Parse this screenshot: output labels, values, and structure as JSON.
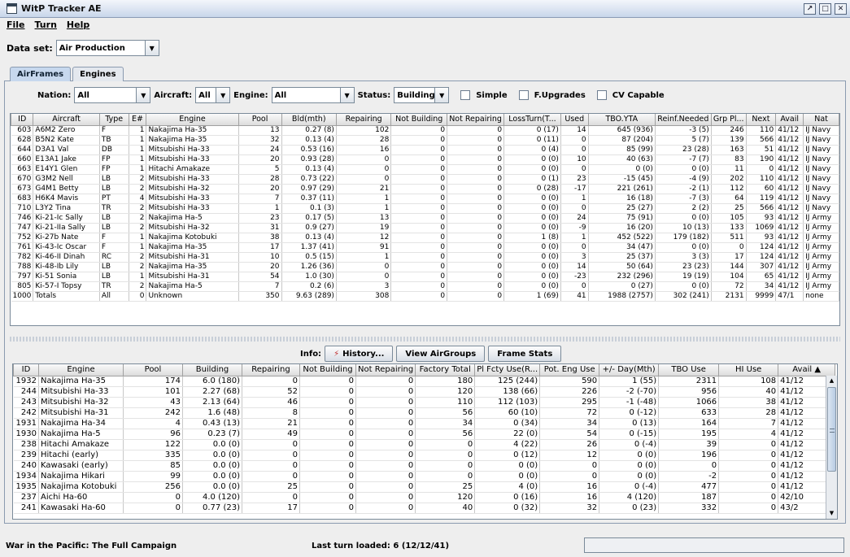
{
  "window": {
    "title": "WitP Tracker AE",
    "buttons": [
      "↗",
      "□",
      "✕"
    ]
  },
  "menu": [
    "File",
    "Turn",
    "Help"
  ],
  "dataset": {
    "label": "Data set:",
    "value": "Air Production"
  },
  "tabs": [
    "AirFrames",
    "Engines"
  ],
  "filters": {
    "nation_label": "Nation:",
    "nation": "All",
    "aircraft_label": "Aircraft:",
    "aircraft": "All",
    "engine_label": "Engine:",
    "engine": "All",
    "status_label": "Status:",
    "status": "Building",
    "simple": "Simple",
    "fupgrades": "F.Upgrades",
    "cvcapable": "CV Capable"
  },
  "airframes": {
    "columns": [
      "ID",
      "Aircraft",
      "Type",
      "E#",
      "Engine",
      "Pool",
      "Bld(mth)",
      "Repairing",
      "Not Building",
      "Not Repairing",
      "LossTurn(T...",
      "Used",
      "TBO.YTA",
      "Reinf.Needed",
      "Grp Pl...",
      "Next",
      "Avail",
      "Nat"
    ],
    "rows": [
      [
        "603",
        "A6M2 Zero",
        "F",
        "1",
        "Nakajima Ha-35",
        "13",
        "0.27 (8)",
        "102",
        "0",
        "0",
        "0 (17)",
        "14",
        "645 (936)",
        "-3 (5)",
        "246",
        "110",
        "41/12",
        "IJ Navy"
      ],
      [
        "628",
        "B5N2 Kate",
        "TB",
        "1",
        "Nakajima Ha-35",
        "32",
        "0.13 (4)",
        "28",
        "0",
        "0",
        "0 (11)",
        "0",
        "87 (204)",
        "5 (7)",
        "139",
        "566",
        "41/12",
        "IJ Navy"
      ],
      [
        "644",
        "D3A1 Val",
        "DB",
        "1",
        "Mitsubishi Ha-33",
        "24",
        "0.53 (16)",
        "16",
        "0",
        "0",
        "0 (4)",
        "0",
        "85 (99)",
        "23 (28)",
        "163",
        "51",
        "41/12",
        "IJ Navy"
      ],
      [
        "660",
        "E13A1 Jake",
        "FP",
        "1",
        "Mitsubishi Ha-33",
        "20",
        "0.93 (28)",
        "0",
        "0",
        "0",
        "0 (0)",
        "10",
        "40 (63)",
        "-7 (7)",
        "83",
        "190",
        "41/12",
        "IJ Navy"
      ],
      [
        "663",
        "E14Y1 Glen",
        "FP",
        "1",
        "Hitachi Amakaze",
        "5",
        "0.13 (4)",
        "0",
        "0",
        "0",
        "0 (0)",
        "0",
        "0 (0)",
        "0 (0)",
        "11",
        "0",
        "41/12",
        "IJ Navy"
      ],
      [
        "670",
        "G3M2 Nell",
        "LB",
        "2",
        "Mitsubishi Ha-33",
        "28",
        "0.73 (22)",
        "0",
        "0",
        "0",
        "0 (1)",
        "23",
        "-15 (45)",
        "-4 (9)",
        "202",
        "110",
        "41/12",
        "IJ Navy"
      ],
      [
        "673",
        "G4M1 Betty",
        "LB",
        "2",
        "Mitsubishi Ha-32",
        "20",
        "0.97 (29)",
        "21",
        "0",
        "0",
        "0 (28)",
        "-17",
        "221 (261)",
        "-2 (1)",
        "112",
        "60",
        "41/12",
        "IJ Navy"
      ],
      [
        "683",
        "H6K4 Mavis",
        "PT",
        "4",
        "Mitsubishi Ha-33",
        "7",
        "0.37 (11)",
        "1",
        "0",
        "0",
        "0 (0)",
        "1",
        "16 (18)",
        "-7 (3)",
        "64",
        "119",
        "41/12",
        "IJ Navy"
      ],
      [
        "710",
        "L3Y2 Tina",
        "TR",
        "2",
        "Mitsubishi Ha-33",
        "1",
        "0.1 (3)",
        "1",
        "0",
        "0",
        "0 (0)",
        "0",
        "25 (27)",
        "2 (2)",
        "25",
        "566",
        "41/12",
        "IJ Navy"
      ],
      [
        "746",
        "Ki-21-Ic Sally",
        "LB",
        "2",
        "Nakajima Ha-5",
        "23",
        "0.17 (5)",
        "13",
        "0",
        "0",
        "0 (0)",
        "24",
        "75 (91)",
        "0 (0)",
        "105",
        "93",
        "41/12",
        "IJ Army"
      ],
      [
        "747",
        "Ki-21-IIa Sally",
        "LB",
        "2",
        "Mitsubishi Ha-32",
        "31",
        "0.9 (27)",
        "19",
        "0",
        "0",
        "0 (0)",
        "-9",
        "16 (20)",
        "10 (13)",
        "133",
        "1069",
        "41/12",
        "IJ Army"
      ],
      [
        "752",
        "Ki-27b Nate",
        "F",
        "1",
        "Nakajima Kotobuki",
        "38",
        "0.13 (4)",
        "12",
        "0",
        "0",
        "1 (8)",
        "1",
        "452 (522)",
        "179 (182)",
        "511",
        "93",
        "41/12",
        "IJ Army"
      ],
      [
        "761",
        "Ki-43-Ic Oscar",
        "F",
        "1",
        "Nakajima Ha-35",
        "17",
        "1.37 (41)",
        "91",
        "0",
        "0",
        "0 (0)",
        "0",
        "34 (47)",
        "0 (0)",
        "0",
        "124",
        "41/12",
        "IJ Army"
      ],
      [
        "782",
        "Ki-46-II Dinah",
        "RC",
        "2",
        "Mitsubishi Ha-31",
        "10",
        "0.5 (15)",
        "1",
        "0",
        "0",
        "0 (0)",
        "3",
        "25 (37)",
        "3 (3)",
        "17",
        "124",
        "41/12",
        "IJ Army"
      ],
      [
        "788",
        "Ki-48-Ib Lily",
        "LB",
        "2",
        "Nakajima Ha-35",
        "20",
        "1.26 (36)",
        "0",
        "0",
        "0",
        "0 (0)",
        "14",
        "50 (64)",
        "23 (23)",
        "144",
        "307",
        "41/12",
        "IJ Army"
      ],
      [
        "797",
        "Ki-51 Sonia",
        "LB",
        "1",
        "Mitsubishi Ha-31",
        "54",
        "1.0 (30)",
        "0",
        "0",
        "0",
        "0 (0)",
        "-23",
        "232 (296)",
        "19 (19)",
        "104",
        "65",
        "41/12",
        "IJ Army"
      ],
      [
        "805",
        "Ki-57-I Topsy",
        "TR",
        "2",
        "Nakajima Ha-5",
        "7",
        "0.2 (6)",
        "3",
        "0",
        "0",
        "0 (0)",
        "0",
        "0 (27)",
        "0 (0)",
        "72",
        "34",
        "41/12",
        "IJ Army"
      ],
      [
        "1000",
        "Totals",
        "All",
        "0",
        "Unknown",
        "350",
        "9.63 (289)",
        "308",
        "0",
        "0",
        "1 (69)",
        "41",
        "1988 (2757)",
        "302 (241)",
        "2131",
        "9999",
        "47/1",
        "none"
      ]
    ]
  },
  "info": {
    "label": "Info:",
    "history": "History...",
    "view_airgroups": "View AirGroups",
    "frame_stats": "Frame Stats"
  },
  "engines": {
    "columns": [
      "ID",
      "Engine",
      "Pool",
      "Building",
      "Repairing",
      "Not Building",
      "Not Repairing",
      "Factory Total",
      "Pl Fcty Use(R...",
      "Pot. Eng Use",
      "+/- Day(Mth)",
      "TBO Use",
      "HI Use",
      "Avail ▲"
    ],
    "rows": [
      [
        "1932",
        "Nakajima Ha-35",
        "174",
        "6.0 (180)",
        "0",
        "0",
        "0",
        "180",
        "125 (244)",
        "590",
        "1 (55)",
        "2311",
        "108",
        "41/12"
      ],
      [
        "244",
        "Mitsubishi Ha-33",
        "101",
        "2.27 (68)",
        "52",
        "0",
        "0",
        "120",
        "138 (66)",
        "226",
        "-2 (-70)",
        "956",
        "40",
        "41/12"
      ],
      [
        "243",
        "Mitsubishi Ha-32",
        "43",
        "2.13 (64)",
        "46",
        "0",
        "0",
        "110",
        "112 (103)",
        "295",
        "-1 (-48)",
        "1066",
        "38",
        "41/12"
      ],
      [
        "242",
        "Mitsubishi Ha-31",
        "242",
        "1.6 (48)",
        "8",
        "0",
        "0",
        "56",
        "60 (10)",
        "72",
        "0 (-12)",
        "633",
        "28",
        "41/12"
      ],
      [
        "1931",
        "Nakajima Ha-34",
        "4",
        "0.43 (13)",
        "21",
        "0",
        "0",
        "34",
        "0 (34)",
        "34",
        "0 (13)",
        "164",
        "7",
        "41/12"
      ],
      [
        "1930",
        "Nakajima Ha-5",
        "96",
        "0.23 (7)",
        "49",
        "0",
        "0",
        "56",
        "22 (0)",
        "54",
        "0 (-15)",
        "195",
        "4",
        "41/12"
      ],
      [
        "238",
        "Hitachi Amakaze",
        "122",
        "0.0 (0)",
        "0",
        "0",
        "0",
        "0",
        "4 (22)",
        "26",
        "0 (-4)",
        "39",
        "0",
        "41/12"
      ],
      [
        "239",
        "Hitachi (early)",
        "335",
        "0.0 (0)",
        "0",
        "0",
        "0",
        "0",
        "0 (12)",
        "12",
        "0 (0)",
        "196",
        "0",
        "41/12"
      ],
      [
        "240",
        "Kawasaki (early)",
        "85",
        "0.0 (0)",
        "0",
        "0",
        "0",
        "0",
        "0 (0)",
        "0",
        "0 (0)",
        "0",
        "0",
        "41/12"
      ],
      [
        "1934",
        "Nakajima Hikari",
        "99",
        "0.0 (0)",
        "0",
        "0",
        "0",
        "0",
        "0 (0)",
        "0",
        "0 (0)",
        "-2",
        "0",
        "41/12"
      ],
      [
        "1935",
        "Nakajima Kotobuki",
        "256",
        "0.0 (0)",
        "25",
        "0",
        "0",
        "25",
        "4 (0)",
        "16",
        "0 (-4)",
        "477",
        "0",
        "41/12"
      ],
      [
        "237",
        "Aichi Ha-60",
        "0",
        "4.0 (120)",
        "0",
        "0",
        "0",
        "120",
        "0 (16)",
        "16",
        "4 (120)",
        "187",
        "0",
        "42/10"
      ],
      [
        "241",
        "Kawasaki Ha-60",
        "0",
        "0.77 (23)",
        "17",
        "0",
        "0",
        "40",
        "0 (32)",
        "32",
        "0 (23)",
        "332",
        "0",
        "43/2"
      ]
    ]
  },
  "status": {
    "left": "War in the Pacific: The Full Campaign",
    "mid": "Last turn loaded: 6 (12/12/41)"
  }
}
